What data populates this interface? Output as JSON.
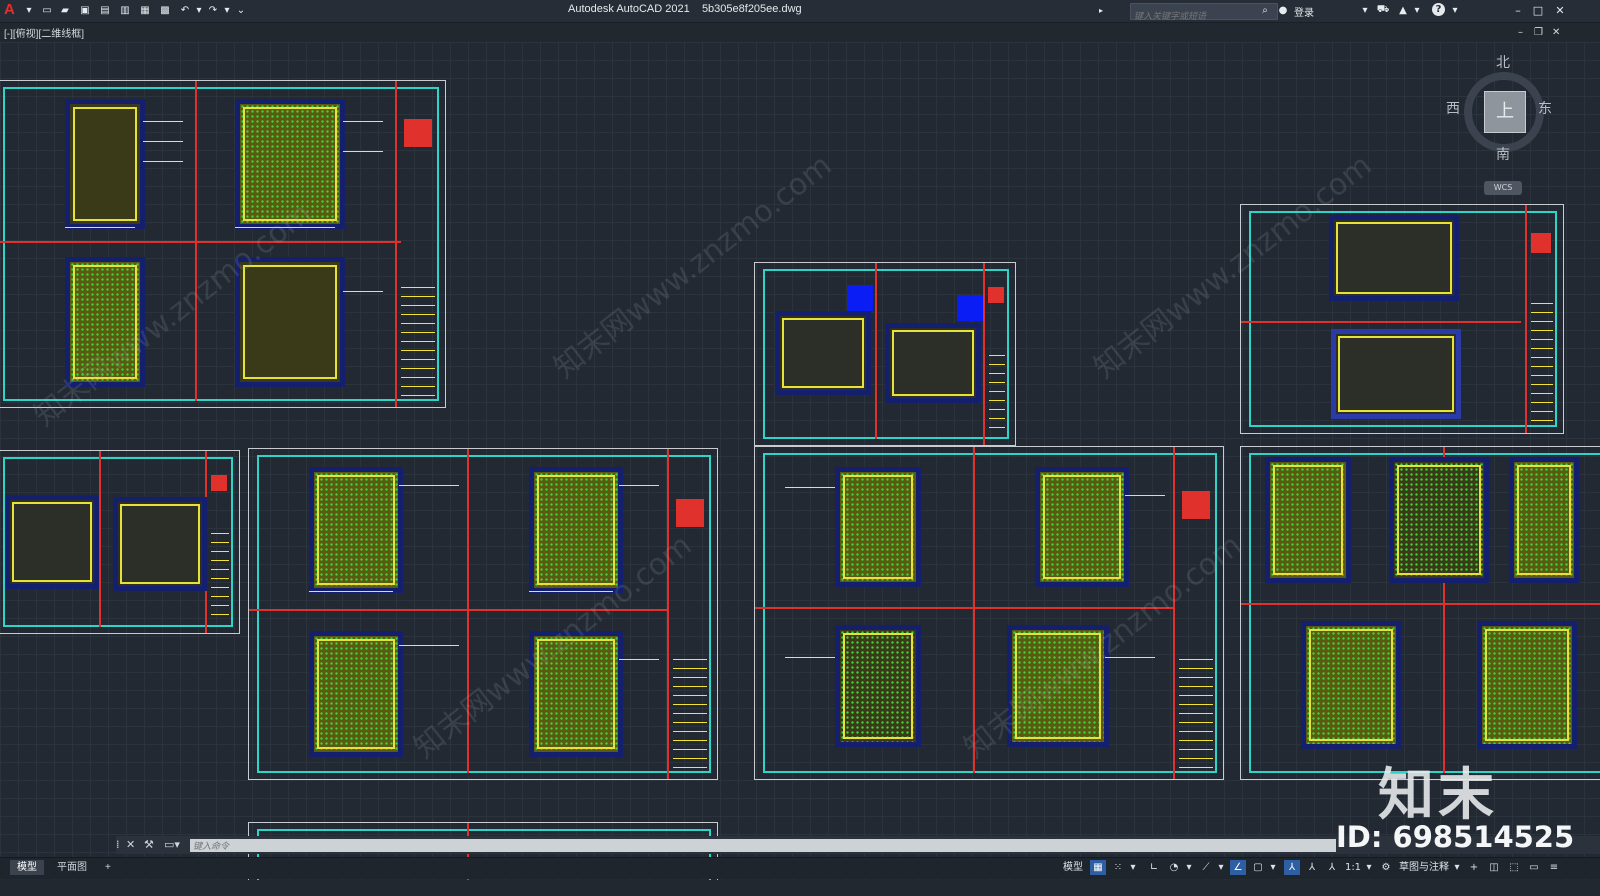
{
  "window": {
    "app_name": "Autodesk AutoCAD 2021",
    "file_name": "5b305e8f205ee.dwg",
    "logo_letter": "A"
  },
  "header": {
    "search_placeholder": "键入关键字或短语",
    "login_label": "登录",
    "help_label": "?"
  },
  "viewport": {
    "label": "[-][俯视][二维线框]"
  },
  "viewcube": {
    "north": "北",
    "south": "南",
    "east": "东",
    "west": "西",
    "face": "上",
    "wcs": "WCS"
  },
  "watermarks": {
    "site": "知末网www.znzmo.com",
    "logo": "知末",
    "id": "ID: 698514525"
  },
  "command": {
    "placeholder": "键入命令"
  },
  "tabs": [
    {
      "label": "模型",
      "active": true
    },
    {
      "label": "平面图",
      "active": false
    },
    {
      "label": "+",
      "active": false
    }
  ],
  "status": {
    "model_label": "模型",
    "scale": "1:1",
    "workspace": "草图与注释"
  },
  "colors": {
    "background": "#222932",
    "sheet_border": "#2fd4c8",
    "title_block_red": "#e0312d",
    "dimension_yellow": "#f0e84a",
    "frame_navy": "#14206e",
    "marker_blue": "#0b1df5"
  }
}
